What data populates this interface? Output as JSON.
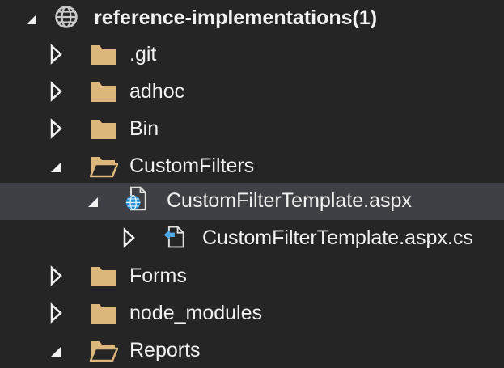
{
  "tree": {
    "root": {
      "label": "reference-implementations(1)",
      "icon": "globe-project-icon",
      "expanded": true
    },
    "items": [
      {
        "label": ".git",
        "icon": "folder-icon",
        "expanded": false
      },
      {
        "label": "adhoc",
        "icon": "folder-icon",
        "expanded": false
      },
      {
        "label": "Bin",
        "icon": "folder-icon",
        "expanded": false
      },
      {
        "label": "CustomFilters",
        "icon": "folder-open-icon",
        "expanded": true
      },
      {
        "label": "CustomFilterTemplate.aspx",
        "icon": "aspx-file-icon",
        "expanded": true,
        "selected": true
      },
      {
        "label": "CustomFilterTemplate.aspx.cs",
        "icon": "code-behind-file-icon",
        "expanded": false
      },
      {
        "label": "Forms",
        "icon": "folder-icon",
        "expanded": false
      },
      {
        "label": "node_modules",
        "icon": "folder-icon",
        "expanded": false
      },
      {
        "label": "Reports",
        "icon": "folder-open-icon",
        "expanded": true
      }
    ]
  },
  "colors": {
    "background": "#252526",
    "selection": "#3f3f46",
    "text": "#f1f1f1",
    "folder": "#dcb67a",
    "globe": "#4fc1ff",
    "chevron": "#f1f1f1"
  }
}
